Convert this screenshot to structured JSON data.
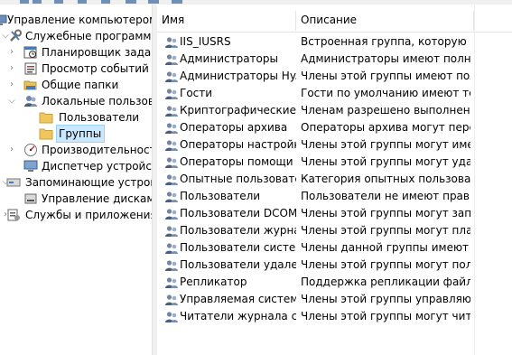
{
  "tree": {
    "root_label": "Управление компьютером (л",
    "items": [
      {
        "label": "Служебные программы"
      },
      {
        "label": "Планировщик заданий"
      },
      {
        "label": "Просмотр событий"
      },
      {
        "label": "Общие папки"
      },
      {
        "label": "Локальные пользовате"
      },
      {
        "label": "Пользователи"
      },
      {
        "label": "Группы"
      },
      {
        "label": "Производительность"
      },
      {
        "label": "Диспетчер устройств"
      },
      {
        "label": "Запоминающие устройст"
      },
      {
        "label": "Управление дисками"
      },
      {
        "label": "Службы и приложения"
      }
    ]
  },
  "list": {
    "columns": {
      "name": "Имя",
      "description": "Описание"
    },
    "rows": [
      {
        "name": "IIS_IUSRS",
        "description": "Встроенная группа, которую ис..."
      },
      {
        "name": "Администраторы",
        "description": "Администраторы имеют полны..."
      },
      {
        "name": "Администраторы Hy...",
        "description": "Члены этой группы имеют пол..."
      },
      {
        "name": "Гости",
        "description": "Гости по умолчанию имеют те ..."
      },
      {
        "name": "Криптографические ...",
        "description": "Членам разрешено выполнени..."
      },
      {
        "name": "Операторы архива",
        "description": "Операторы архива могут перек..."
      },
      {
        "name": "Операторы настройк...",
        "description": "Члены этой группы могут имет..."
      },
      {
        "name": "Операторы помощи ...",
        "description": "Члены этой группы могут удале..."
      },
      {
        "name": "Опытные пользовате",
        "description": "Категория опытных пользовате..."
      },
      {
        "name": "Пользователи",
        "description": "Пользователи не имеют прав на..."
      },
      {
        "name": "Пользователи DCOM",
        "description": "Члены этой группы могут запус..."
      },
      {
        "name": "Пользователи журна...",
        "description": "Члены этой группы могут план..."
      },
      {
        "name": "Пользователи систе...",
        "description": "Члены данной группы имеют ка..."
      },
      {
        "name": "Пользователи удале...",
        "description": "Члены этой группы могут полу..."
      },
      {
        "name": "Репликатор",
        "description": "Поддержка репликации файлов..."
      },
      {
        "name": "Управляемая систем...",
        "description": "Члены этой группы управляютс..."
      },
      {
        "name": "Читатели журнала с...",
        "description": "Члены этой группы могут читат..."
      }
    ]
  },
  "colors": {
    "selection": "#cce8ff",
    "selection_border": "#99d1ff",
    "toolbar_accent": "#6f8fb6"
  }
}
